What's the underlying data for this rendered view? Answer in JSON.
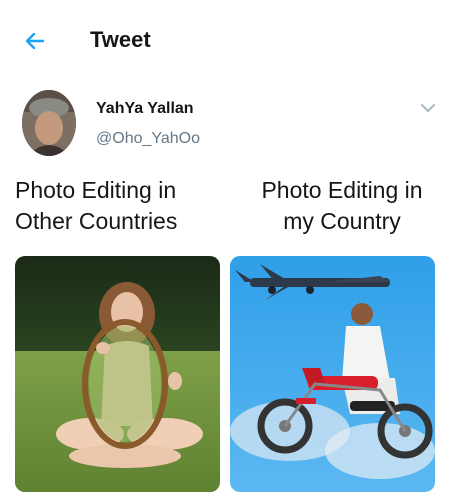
{
  "header": {
    "back_icon": "arrow-left-icon",
    "title": "Tweet"
  },
  "tweet": {
    "author": {
      "display_name": "YahYa Yallan",
      "handle": "@Oho_YahOo",
      "avatar_icon": "profile-photo"
    },
    "more_icon": "chevron-down-icon",
    "captions": {
      "left_line1": "Photo Editing in",
      "left_line2": "Other Countries",
      "right_line1": "Photo Editing in",
      "right_line2": "my Country"
    },
    "images": [
      {
        "name": "photo-girl-with-mirror"
      },
      {
        "name": "photo-man-on-motorbike-with-airplane"
      }
    ]
  },
  "colors": {
    "accent": "#1da1f2",
    "text_primary": "#14171a",
    "text_secondary": "#657786"
  }
}
